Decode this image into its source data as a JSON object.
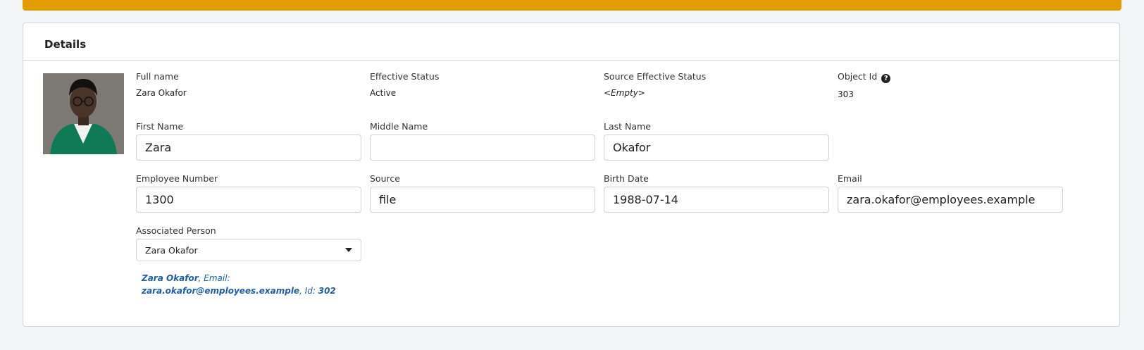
{
  "card": {
    "title": "Details"
  },
  "summary": {
    "full_name": {
      "label": "Full name",
      "value": "Zara Okafor"
    },
    "effective_status": {
      "label": "Effective Status",
      "value": "Active"
    },
    "source_effective_status": {
      "label": "Source Effective Status",
      "value": "<Empty>"
    },
    "object_id": {
      "label": "Object Id",
      "value": "303",
      "help_icon_glyph": "?"
    }
  },
  "form": {
    "first_name": {
      "label": "First Name",
      "value": "Zara"
    },
    "middle_name": {
      "label": "Middle Name",
      "value": ""
    },
    "last_name": {
      "label": "Last Name",
      "value": "Okafor"
    },
    "employee_number": {
      "label": "Employee Number",
      "value": "1300"
    },
    "source": {
      "label": "Source",
      "value": "file"
    },
    "birth_date": {
      "label": "Birth Date",
      "value": "1988-07-14"
    },
    "email": {
      "label": "Email",
      "value": "zara.okafor@employees.example"
    },
    "associated_person": {
      "label": "Associated Person",
      "selected": "Zara Okafor",
      "info": {
        "name": "Zara Okafor",
        "email_label": ", Email: ",
        "email": "zara.okafor@employees.example",
        "id_label": ", Id: ",
        "id": "302"
      }
    }
  },
  "colors": {
    "banner": "#e49b00",
    "link": "#1f5fa8",
    "background": "#f4f5f7"
  }
}
